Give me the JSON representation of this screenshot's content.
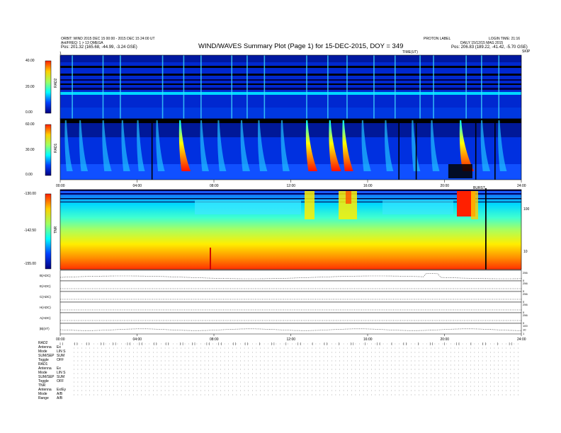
{
  "header": {
    "left_lines": [
      "ORBIT: WIND 2015 DEC 15 00:00 - 2015 DEC 15 24:00 UT",
      "Ant/FREQ: 1 > 13 OMEGA"
    ],
    "left_pos": "Pos:    201.32 (165.68, -44.99, -3.24 GSE)",
    "title": "WIND/WAVES Summary Plot (Page 1) for 15-DEC-2015, DOY = 349",
    "right_top_a": "PROTON LABEL",
    "right_top_b": "LOGIN TIME: 21:16",
    "right_daily": "DAILY 15/12/15 MAG 2015",
    "right_pos": "Pos:    206.83 (189.22, -41.42, -5.70 GSE)",
    "time_label": "TIME(UT)",
    "start_mark": "1",
    "end_mark": "SKIP"
  },
  "chart_data": [
    {
      "type": "heatmap",
      "panel": "RAD2",
      "ylabel": "RAD2",
      "colorbar_ticks": [
        "40.00",
        "20.00",
        "0.00"
      ],
      "colorbar_range": [
        0,
        40
      ],
      "x_hours": [
        0,
        24
      ]
    },
    {
      "type": "heatmap",
      "panel": "RAD1",
      "ylabel": "RAD1",
      "colorbar_ticks": [
        "60.00",
        "30.00",
        "0.00"
      ],
      "colorbar_range": [
        0,
        60
      ],
      "x_hours": [
        0,
        24
      ],
      "x_ticks": [
        "00:00",
        "04:00",
        "08:00",
        "12:00",
        "16:00",
        "20:00",
        "24:00"
      ],
      "annotation": "BURST"
    },
    {
      "type": "heatmap",
      "panel": "TNR",
      "ylabel": "TNR",
      "colorbar_ticks": [
        "-130.00",
        "-142.50",
        "-155.00"
      ],
      "colorbar_range": [
        -155,
        -130
      ],
      "right_ticks": [
        "100",
        "10"
      ],
      "x_hours": [
        0,
        24
      ]
    },
    {
      "type": "line",
      "panels": [
        {
          "label": "B(ADC)",
          "right": [
            "256",
            "0"
          ]
        },
        {
          "label": "E(ADC)",
          "right": [
            "256",
            "0"
          ]
        },
        {
          "label": "C(ADC)",
          "right": [
            "256",
            "0"
          ]
        },
        {
          "label": "H(ADC)",
          "right": [
            "256",
            "0"
          ]
        },
        {
          "label": "A(ADC)",
          "right": [
            "256",
            "0"
          ]
        },
        {
          "label": "|B|(nT)",
          "right": [
            "100",
            "10",
            "1"
          ]
        }
      ],
      "x_ticks": [
        "00:00",
        "04:00",
        "08:00",
        "12:00",
        "16:00",
        "20:00",
        "24:00"
      ]
    }
  ],
  "bottom_info": [
    {
      "key": "RAD2",
      "val": ""
    },
    {
      "key": "Antenna",
      "val": "Ex"
    },
    {
      "key": "Mode",
      "val": "LIN S"
    },
    {
      "key": "SUM/SEP",
      "val": "SUM"
    },
    {
      "key": "Toggle",
      "val": "OFF"
    },
    {
      "key": "RAD1",
      "val": ""
    },
    {
      "key": "Antenna",
      "val": "Ex"
    },
    {
      "key": "Mode",
      "val": "LIN S"
    },
    {
      "key": "SUM/SEP",
      "val": "SUM"
    },
    {
      "key": "Toggle",
      "val": "OFF"
    },
    {
      "key": "TNR",
      "val": ""
    },
    {
      "key": "Antenna",
      "val": "Ex/Ey"
    },
    {
      "key": "Mode",
      "val": "A/B"
    },
    {
      "key": "Range",
      "val": "A/B"
    }
  ]
}
